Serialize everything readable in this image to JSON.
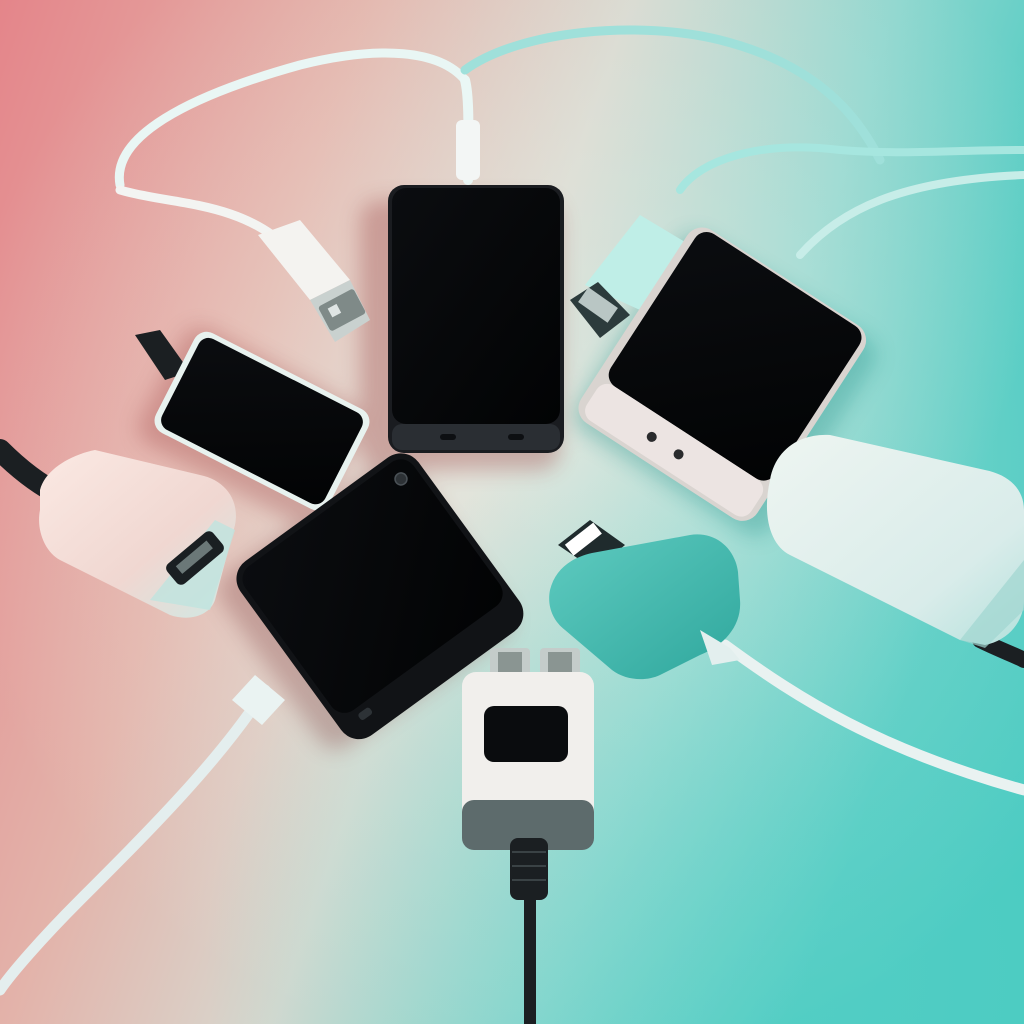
{
  "scene": {
    "subject": "smartphones-chargers-and-cables-on-a-surface",
    "colors": {
      "warm_light": "#e88a8a",
      "cool_light": "#3ccfc4",
      "surface_mid": "#d8d6cf",
      "screen": "#050608",
      "plastic_white": "#eeeeea",
      "teal_plastic": "#46bdb3",
      "cable_white": "#e8ecec",
      "cable_dark": "#1b1f22"
    }
  }
}
